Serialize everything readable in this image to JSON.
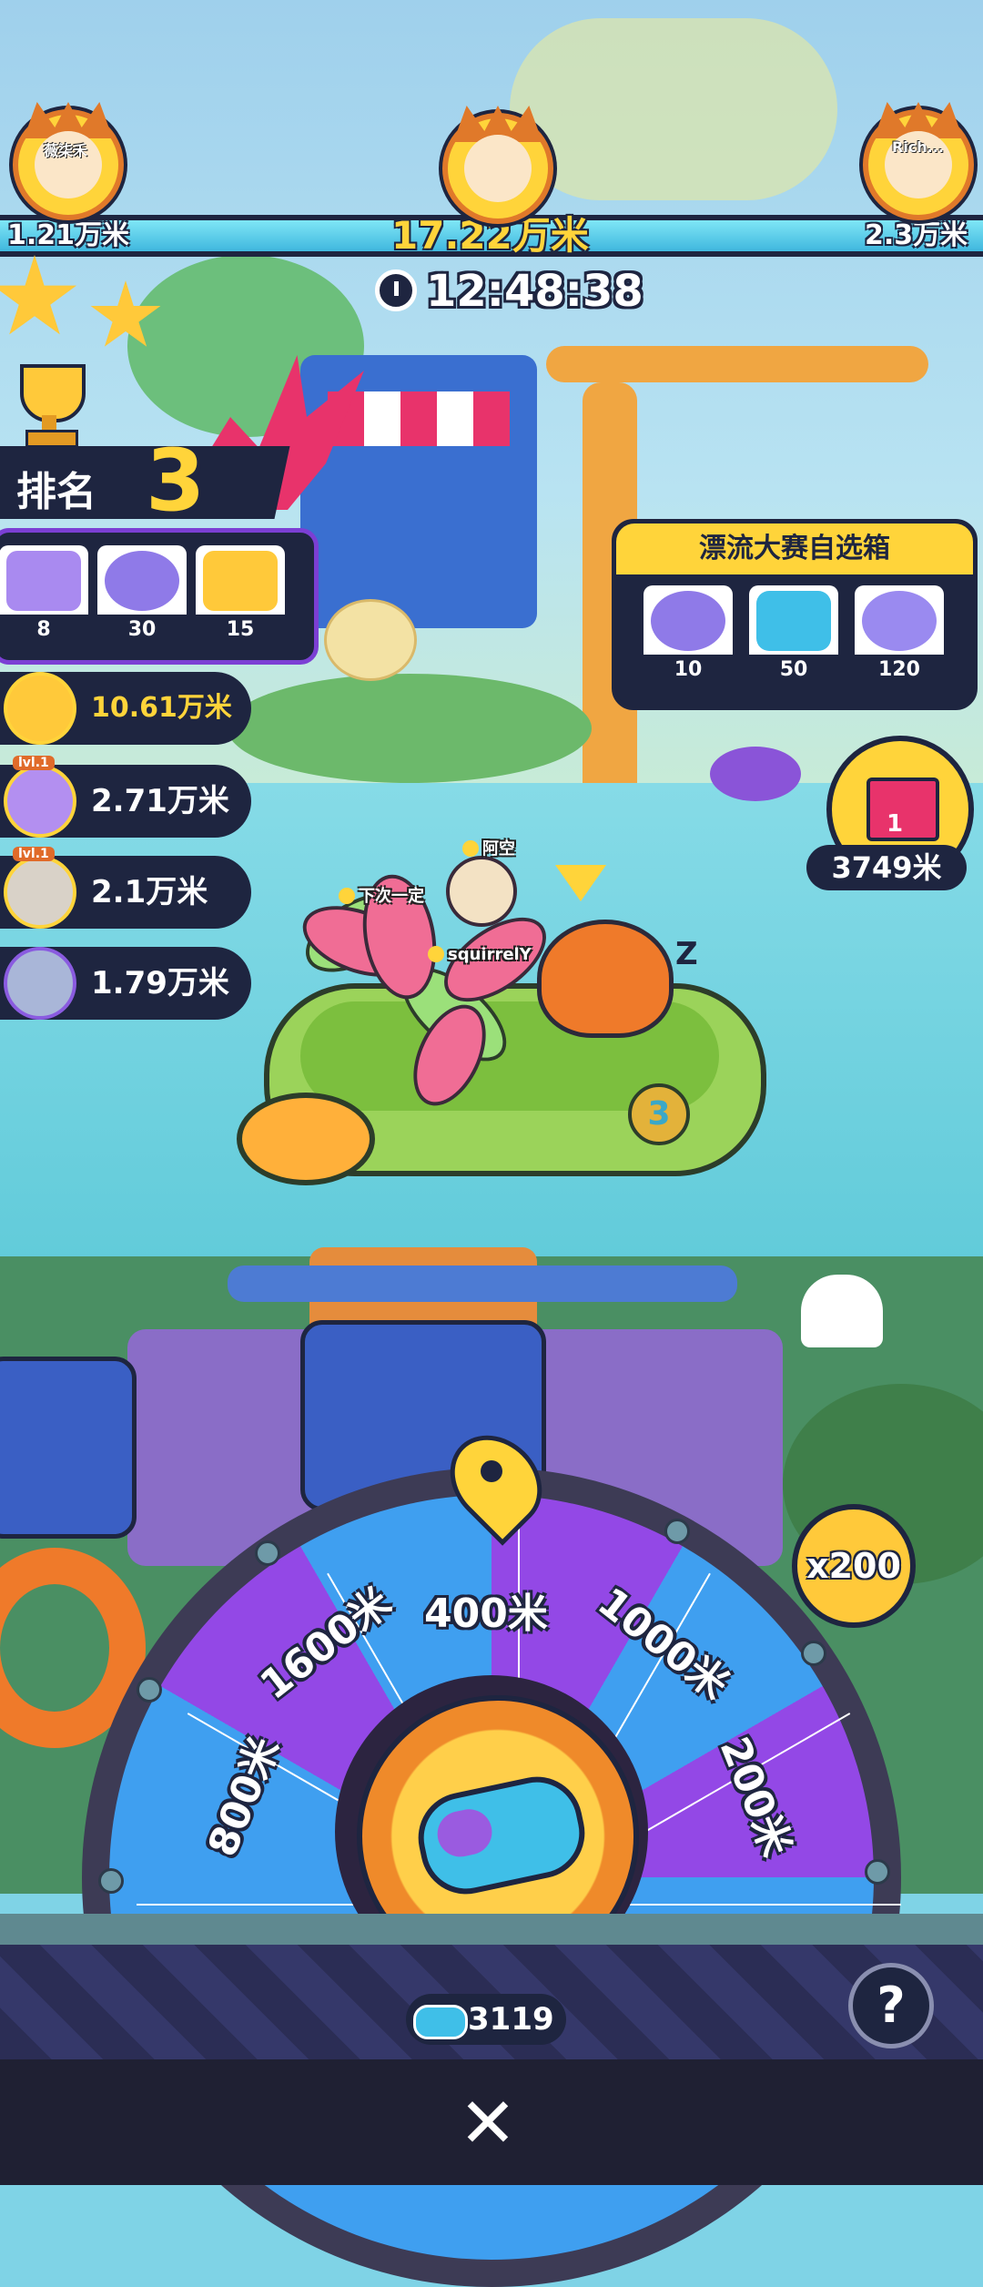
{
  "leaderboard": {
    "left": {
      "name": "薇柒禾",
      "distance": "1.21万米"
    },
    "center": {
      "distance": "17.22万米"
    },
    "right": {
      "name": "Rich...",
      "distance": "2.3万米"
    }
  },
  "timer": {
    "icon": "stopwatch-icon",
    "value": "12:48:38"
  },
  "rank": {
    "label": "排名",
    "number": "3"
  },
  "rank_rewards": [
    {
      "icon": "mystery-box-icon",
      "count": "8"
    },
    {
      "icon": "ghost-capsule-icon",
      "count": "30"
    },
    {
      "icon": "gold-ticket-icon",
      "count": "15"
    }
  ],
  "players": [
    {
      "distance": "10.61万米",
      "level": "",
      "highlight": true
    },
    {
      "distance": "2.71万米",
      "level": "lvl.1",
      "highlight": false
    },
    {
      "distance": "2.1万米",
      "level": "lvl.1",
      "highlight": false
    },
    {
      "distance": "1.79万米",
      "level": "",
      "highlight": false
    }
  ],
  "box_panel": {
    "title": "漂流大赛自选箱",
    "items": [
      {
        "icon": "ghost-capsule-icon",
        "count": "10"
      },
      {
        "icon": "boat-ticket-icon",
        "count": "50"
      },
      {
        "icon": "coin-stack-icon",
        "count": "120"
      }
    ]
  },
  "gift": {
    "count": "1",
    "distance": "3749米"
  },
  "name_tags": [
    "阿空",
    "下次一定",
    "squirrelY"
  ],
  "boat_number": "3",
  "sleep_text": "Z",
  "wheel": {
    "segments": [
      "800米",
      "1600米",
      "400米",
      "1000米",
      "200米"
    ],
    "multiplier": "x200"
  },
  "tickets": {
    "count": "3119"
  },
  "help_label": "?",
  "close_label": "✕"
}
